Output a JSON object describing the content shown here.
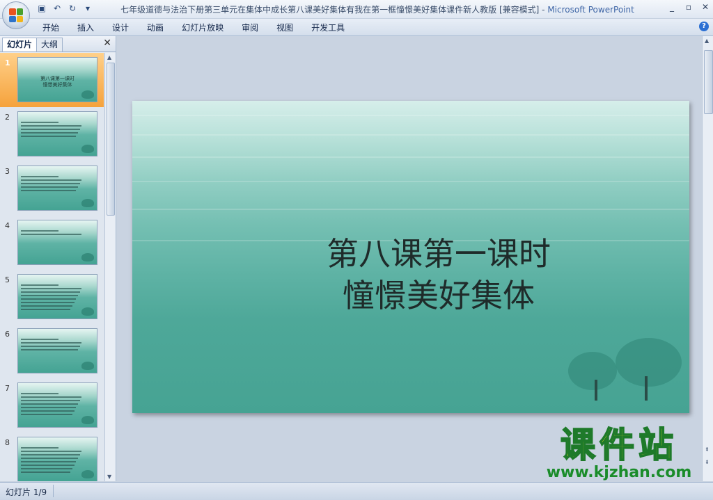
{
  "window": {
    "title": "七年级道德与法治下册第三单元在集体中成长第八课美好集体有我在第一框憧憬美好集体课件新人教版 [兼容模式]",
    "app_name": "Microsoft PowerPoint",
    "separator": " - "
  },
  "quick_access": {
    "icons": [
      "save-icon",
      "undo-icon",
      "redo-icon",
      "customize-icon"
    ]
  },
  "ribbon": {
    "tabs": [
      "开始",
      "插入",
      "设计",
      "动画",
      "幻灯片放映",
      "审阅",
      "视图",
      "开发工具"
    ]
  },
  "panel": {
    "tab_slides": "幻灯片",
    "tab_outline": "大纲",
    "close": "✕",
    "thumbnails": [
      {
        "num": "1",
        "title_lines": [
          "第八课第一课时",
          "憧憬美好集体"
        ],
        "lines": 0
      },
      {
        "num": "2",
        "title_lines": [],
        "lines": 5
      },
      {
        "num": "3",
        "title_lines": [],
        "lines": 5
      },
      {
        "num": "4",
        "title_lines": [],
        "lines": 2
      },
      {
        "num": "5",
        "title_lines": [],
        "lines": 8
      },
      {
        "num": "6",
        "title_lines": [],
        "lines": 4
      },
      {
        "num": "7",
        "title_lines": [],
        "lines": 7
      },
      {
        "num": "8",
        "title_lines": [],
        "lines": 8
      }
    ]
  },
  "slide": {
    "title_line1": "第八课第一课时",
    "title_line2": "憧憬美好集体"
  },
  "status": {
    "slide_info": "幻灯片 1/9"
  },
  "watermark": {
    "text": "课件站",
    "url": "www.kjzhan.com"
  },
  "colors": {
    "slide_teal": "#46a393",
    "selected_thumb": "#f5a23c",
    "watermark_yellow": "#f2e41a",
    "watermark_green": "#1a8c2a"
  }
}
